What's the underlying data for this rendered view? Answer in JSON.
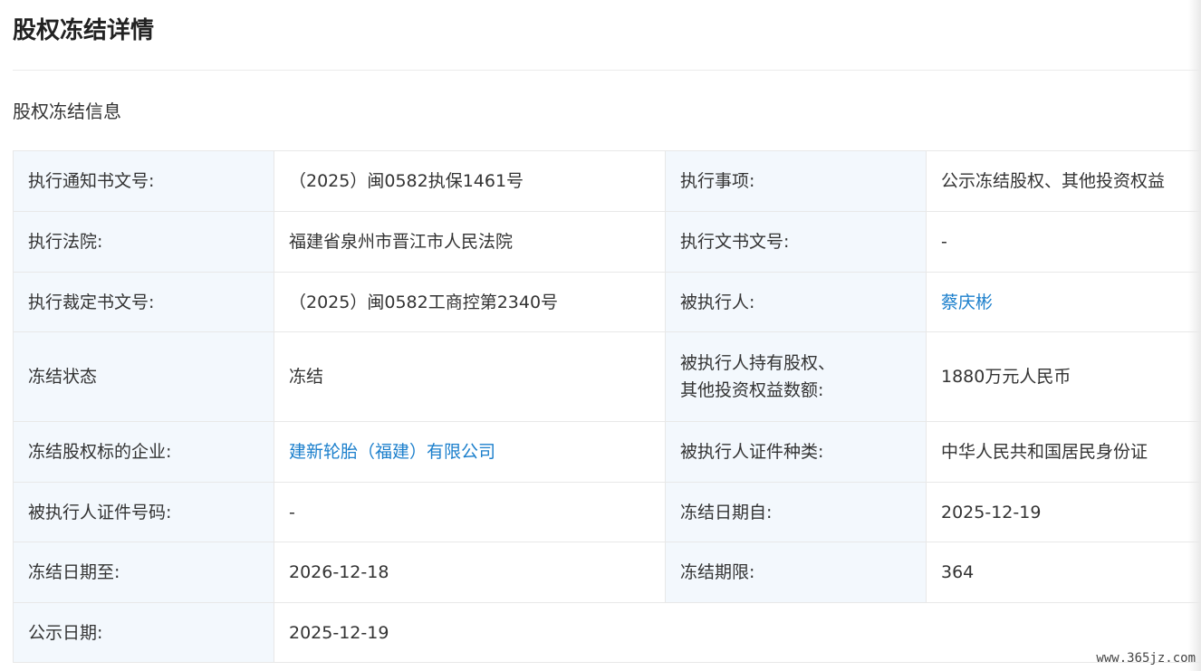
{
  "page": {
    "title": "股权冻结详情",
    "section_title": "股权冻结信息"
  },
  "rows": [
    {
      "label1": "执行通知书文号:",
      "value1": "（2025）闽0582执保1461号",
      "label2": "执行事项:",
      "value2": "公示冻结股权、其他投资权益"
    },
    {
      "label1": "执行法院:",
      "value1": "福建省泉州市晋江市人民法院",
      "label2": "执行文书文号:",
      "value2": "-"
    },
    {
      "label1": "执行裁定书文号:",
      "value1": "（2025）闽0582工商控第2340号",
      "label2": "被执行人:",
      "value2": "蔡庆彬"
    },
    {
      "label1": "冻结状态",
      "value1": "冻结",
      "label2a": "被执行人持有股权、",
      "label2b": "其他投资权益数额:",
      "value2": "1880万元人民币"
    },
    {
      "label1": "冻结股权标的企业:",
      "value1": "建新轮胎（福建）有限公司",
      "label2": "被执行人证件种类:",
      "value2": "中华人民共和国居民身份证"
    },
    {
      "label1": "被执行人证件号码:",
      "value1": "-",
      "label2": "冻结日期自:",
      "value2": "2025-12-19"
    },
    {
      "label1": "冻结日期至:",
      "value1": "2026-12-18",
      "label2": "冻结期限:",
      "value2": "364"
    },
    {
      "label1": "公示日期:",
      "value1": "2025-12-19"
    }
  ],
  "watermark": "www.365jz.com",
  "colors": {
    "label_bg": "#f3f8fd",
    "link": "#1b7fcc",
    "border": "#e8e8e8"
  }
}
